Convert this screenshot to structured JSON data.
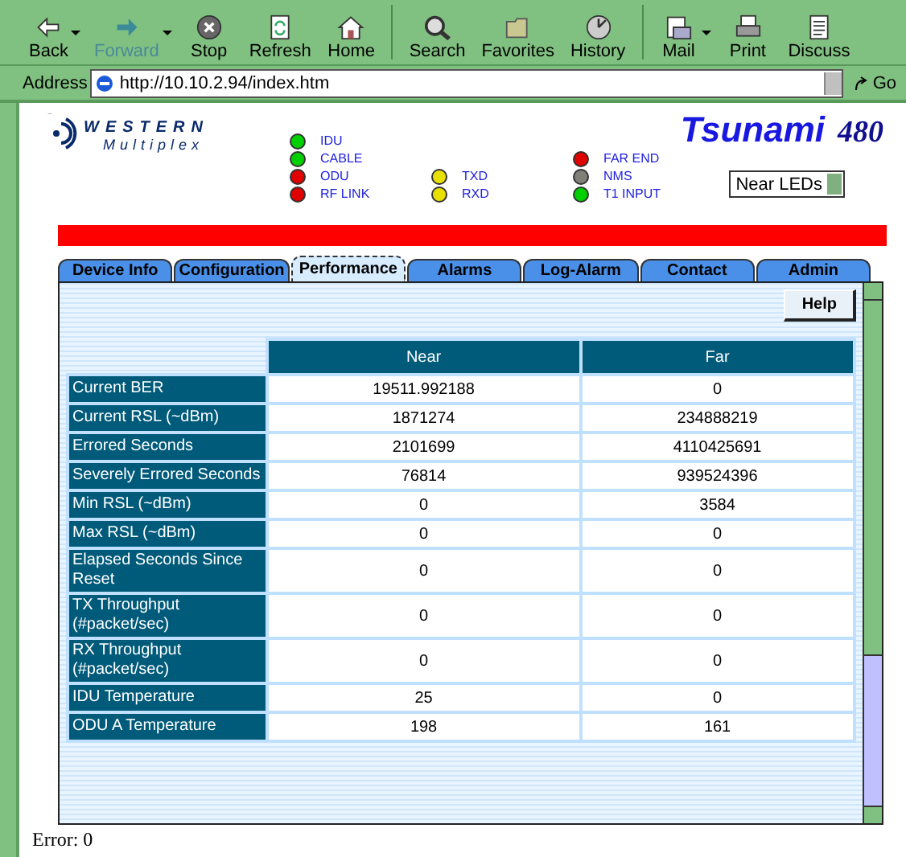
{
  "toolbar": [
    {
      "label": "Back",
      "dropdown": true,
      "disabled": false
    },
    {
      "label": "Forward",
      "dropdown": true,
      "disabled": true
    },
    {
      "label": "Stop",
      "dropdown": false,
      "disabled": false
    },
    {
      "label": "Refresh",
      "dropdown": false,
      "disabled": false
    },
    {
      "label": "Home",
      "dropdown": false,
      "disabled": false
    },
    {
      "label": "Search",
      "dropdown": false,
      "disabled": false
    },
    {
      "label": "Favorites",
      "dropdown": false,
      "disabled": false
    },
    {
      "label": "History",
      "dropdown": false,
      "disabled": false
    },
    {
      "label": "Mail",
      "dropdown": true,
      "disabled": false
    },
    {
      "label": "Print",
      "dropdown": false,
      "disabled": false
    },
    {
      "label": "Discuss",
      "dropdown": false,
      "disabled": false
    }
  ],
  "address": {
    "label": "Address",
    "value": "http://10.10.2.94/index.htm",
    "go": "Go"
  },
  "logo": {
    "name": "WESTERN",
    "sub": "Multiplex"
  },
  "product": {
    "name": "Tsunami",
    "model": "480"
  },
  "led_columns": [
    [
      {
        "label": "IDU",
        "color": "#00d000"
      },
      {
        "label": "CABLE",
        "color": "#00d000"
      },
      {
        "label": "ODU",
        "color": "#e00000"
      },
      {
        "label": "RF LINK",
        "color": "#e00000"
      }
    ],
    [
      null,
      null,
      {
        "label": "TXD",
        "color": "#e8e000"
      },
      {
        "label": "RXD",
        "color": "#e8e000"
      }
    ],
    [
      null,
      {
        "label": "FAR END",
        "color": "#e00000"
      },
      {
        "label": "NMS",
        "color": "#808078"
      },
      {
        "label": "T1 INPUT",
        "color": "#00d000"
      }
    ]
  ],
  "led_select": {
    "value": "Near LEDs"
  },
  "tabs": [
    {
      "label": "Device Info",
      "selected": false
    },
    {
      "label": "Configuration",
      "selected": false
    },
    {
      "label": "Performance",
      "selected": true
    },
    {
      "label": "Alarms",
      "selected": false
    },
    {
      "label": "Log-Alarm",
      "selected": false
    },
    {
      "label": "Contact",
      "selected": false
    },
    {
      "label": "Admin",
      "selected": false
    }
  ],
  "help_button": "Help",
  "table": {
    "columns": [
      "Near",
      "Far"
    ],
    "rows": [
      {
        "label": "Current BER",
        "near": "19511.992188",
        "far": "0"
      },
      {
        "label": "Current RSL (~dBm)",
        "near": "1871274",
        "far": "234888219"
      },
      {
        "label": "Errored Seconds",
        "near": "2101699",
        "far": "4110425691"
      },
      {
        "label": "Severely Errored Seconds",
        "near": "76814",
        "far": "939524396"
      },
      {
        "label": "Min RSL (~dBm)",
        "near": "0",
        "far": "3584"
      },
      {
        "label": "Max RSL (~dBm)",
        "near": "0",
        "far": "0"
      },
      {
        "label": "Elapsed Seconds Since Reset",
        "near": "0",
        "far": "0"
      },
      {
        "label": "TX Throughput (#packet/sec)",
        "near": "0",
        "far": "0"
      },
      {
        "label": "RX Throughput (#packet/sec)",
        "near": "0",
        "far": "0"
      },
      {
        "label": "IDU Temperature",
        "near": "25",
        "far": "0"
      },
      {
        "label": "ODU A Temperature",
        "near": "198",
        "far": "161"
      }
    ]
  },
  "status": "Error: 0"
}
